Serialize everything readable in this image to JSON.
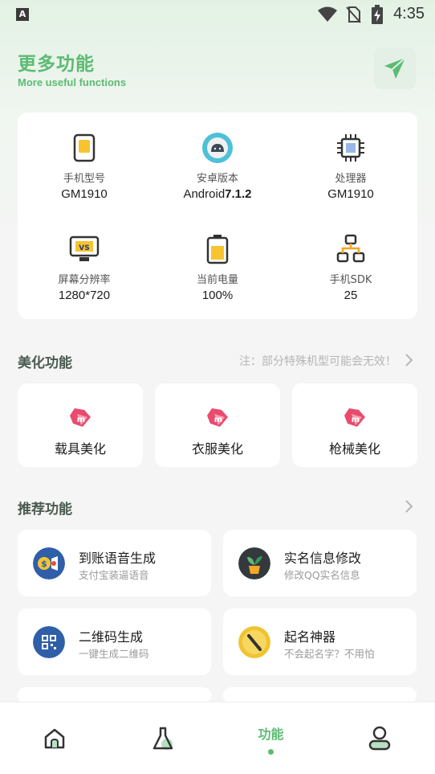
{
  "status": {
    "time": "4:35",
    "app_indicator": "A"
  },
  "header": {
    "title": "更多功能",
    "subtitle": "More useful functions"
  },
  "device_info": [
    {
      "label": "手机型号",
      "value": "GM1910",
      "value_bold": "",
      "icon": "phone-icon"
    },
    {
      "label": "安卓版本",
      "value": "Android",
      "value_bold": "7.1.2",
      "icon": "android-icon"
    },
    {
      "label": "处理器",
      "value": "GM1910",
      "value_bold": "",
      "icon": "cpu-icon"
    },
    {
      "label": "屏幕分辨率",
      "value": "1280*720",
      "value_bold": "",
      "icon": "monitor-icon"
    },
    {
      "label": "当前电量",
      "value": "100%",
      "value_bold": "",
      "icon": "battery-icon"
    },
    {
      "label": "手机SDK",
      "value": "25",
      "value_bold": "",
      "icon": "network-icon"
    }
  ],
  "beauty": {
    "title": "美化功能",
    "note": "注：部分特殊机型可能会无效！",
    "items": [
      {
        "label": "载具美化",
        "icon": "gem-icon"
      },
      {
        "label": "衣服美化",
        "icon": "gem-icon"
      },
      {
        "label": "枪械美化",
        "icon": "gem-icon"
      }
    ]
  },
  "recommend": {
    "title": "推荐功能",
    "items": [
      {
        "title": "到账语音生成",
        "subtitle": "支付宝装逼语音",
        "icon": "payment-voice-icon"
      },
      {
        "title": "实名信息修改",
        "subtitle": "修改QQ实名信息",
        "icon": "plant-icon"
      },
      {
        "title": "二维码生成",
        "subtitle": "一键生成二维码",
        "icon": "qrcode-icon"
      },
      {
        "title": "起名神器",
        "subtitle": "不会起名字？不用怕",
        "icon": "pen-icon"
      }
    ]
  },
  "nav": {
    "active_label": "功能"
  },
  "colors": {
    "accent": "#5cbb73",
    "background": "#f4f5f4"
  }
}
